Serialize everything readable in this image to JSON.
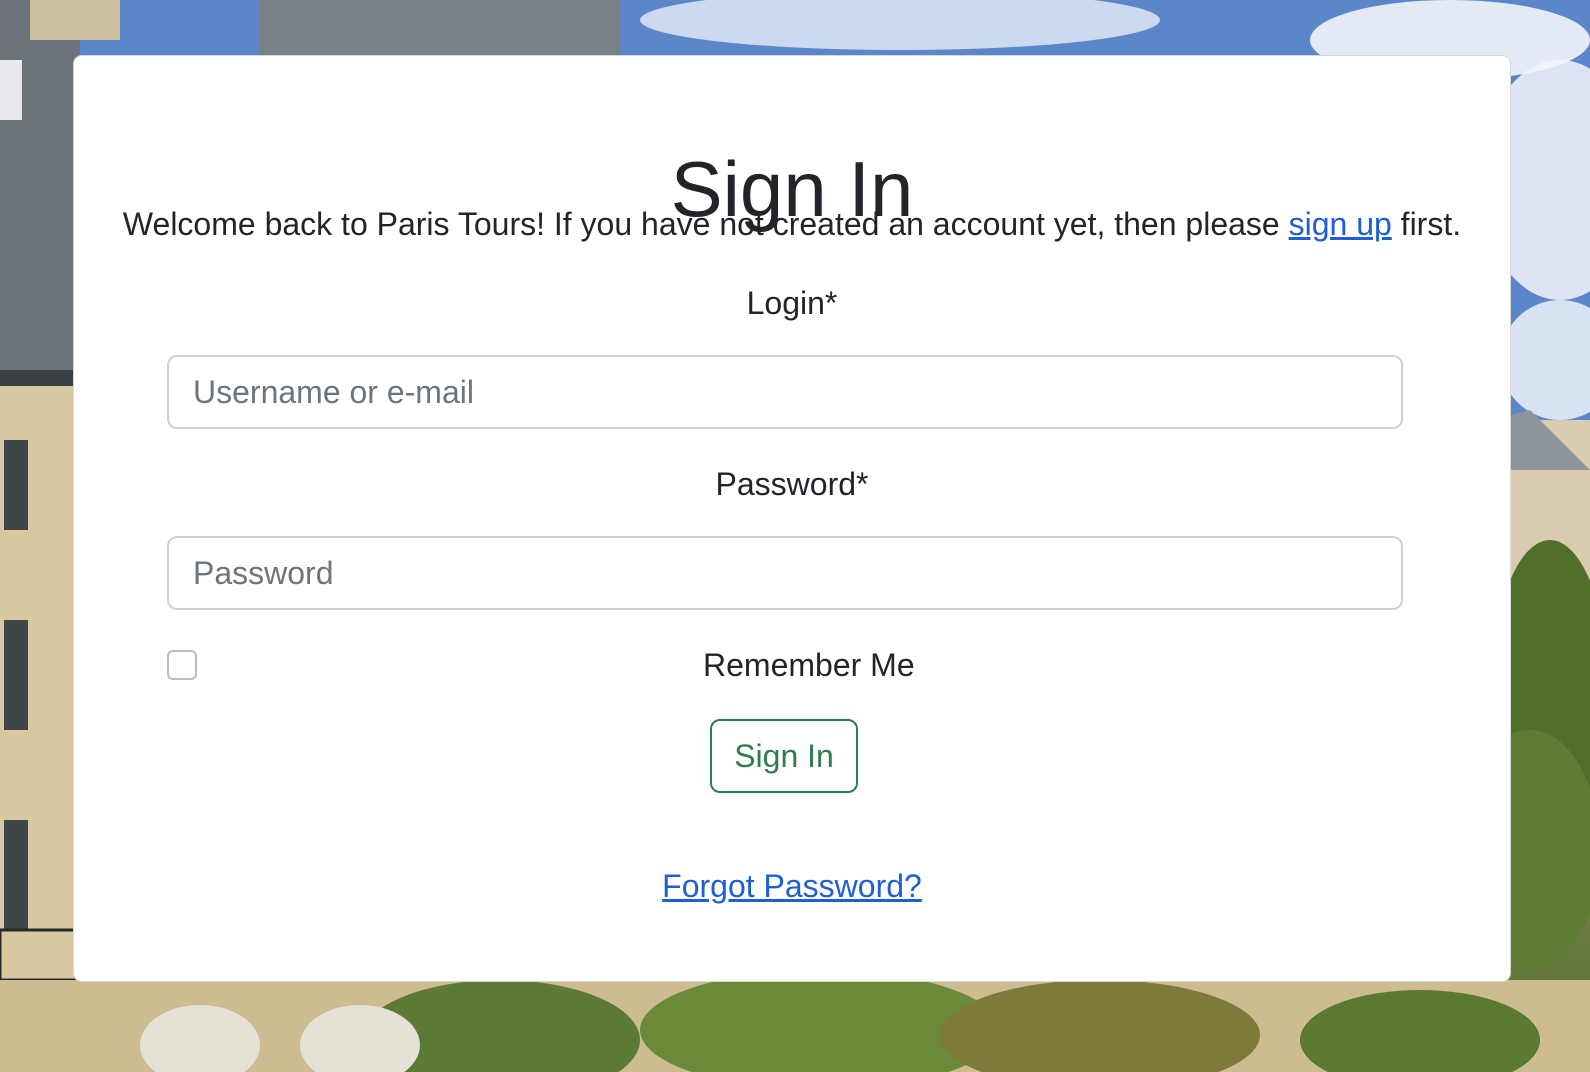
{
  "page": {
    "title": "Sign In",
    "intro_before": "Welcome back to Paris Tours! If you have not created an account yet, then please ",
    "signup_link": "sign up",
    "intro_after": " first."
  },
  "form": {
    "login_label": "Login*",
    "login_placeholder": "Username or e-mail",
    "login_value": "",
    "password_label": "Password*",
    "password_placeholder": "Password",
    "password_value": "",
    "remember_label": "Remember Me",
    "remember_checked": false,
    "submit_label": "Sign In",
    "forgot_label": "Forgot Password?"
  },
  "colors": {
    "text": "#212529",
    "link": "#1e5fd6",
    "button_accent": "#2e7d4f",
    "input_border": "#cdd1d5",
    "placeholder": "#6c757d"
  }
}
